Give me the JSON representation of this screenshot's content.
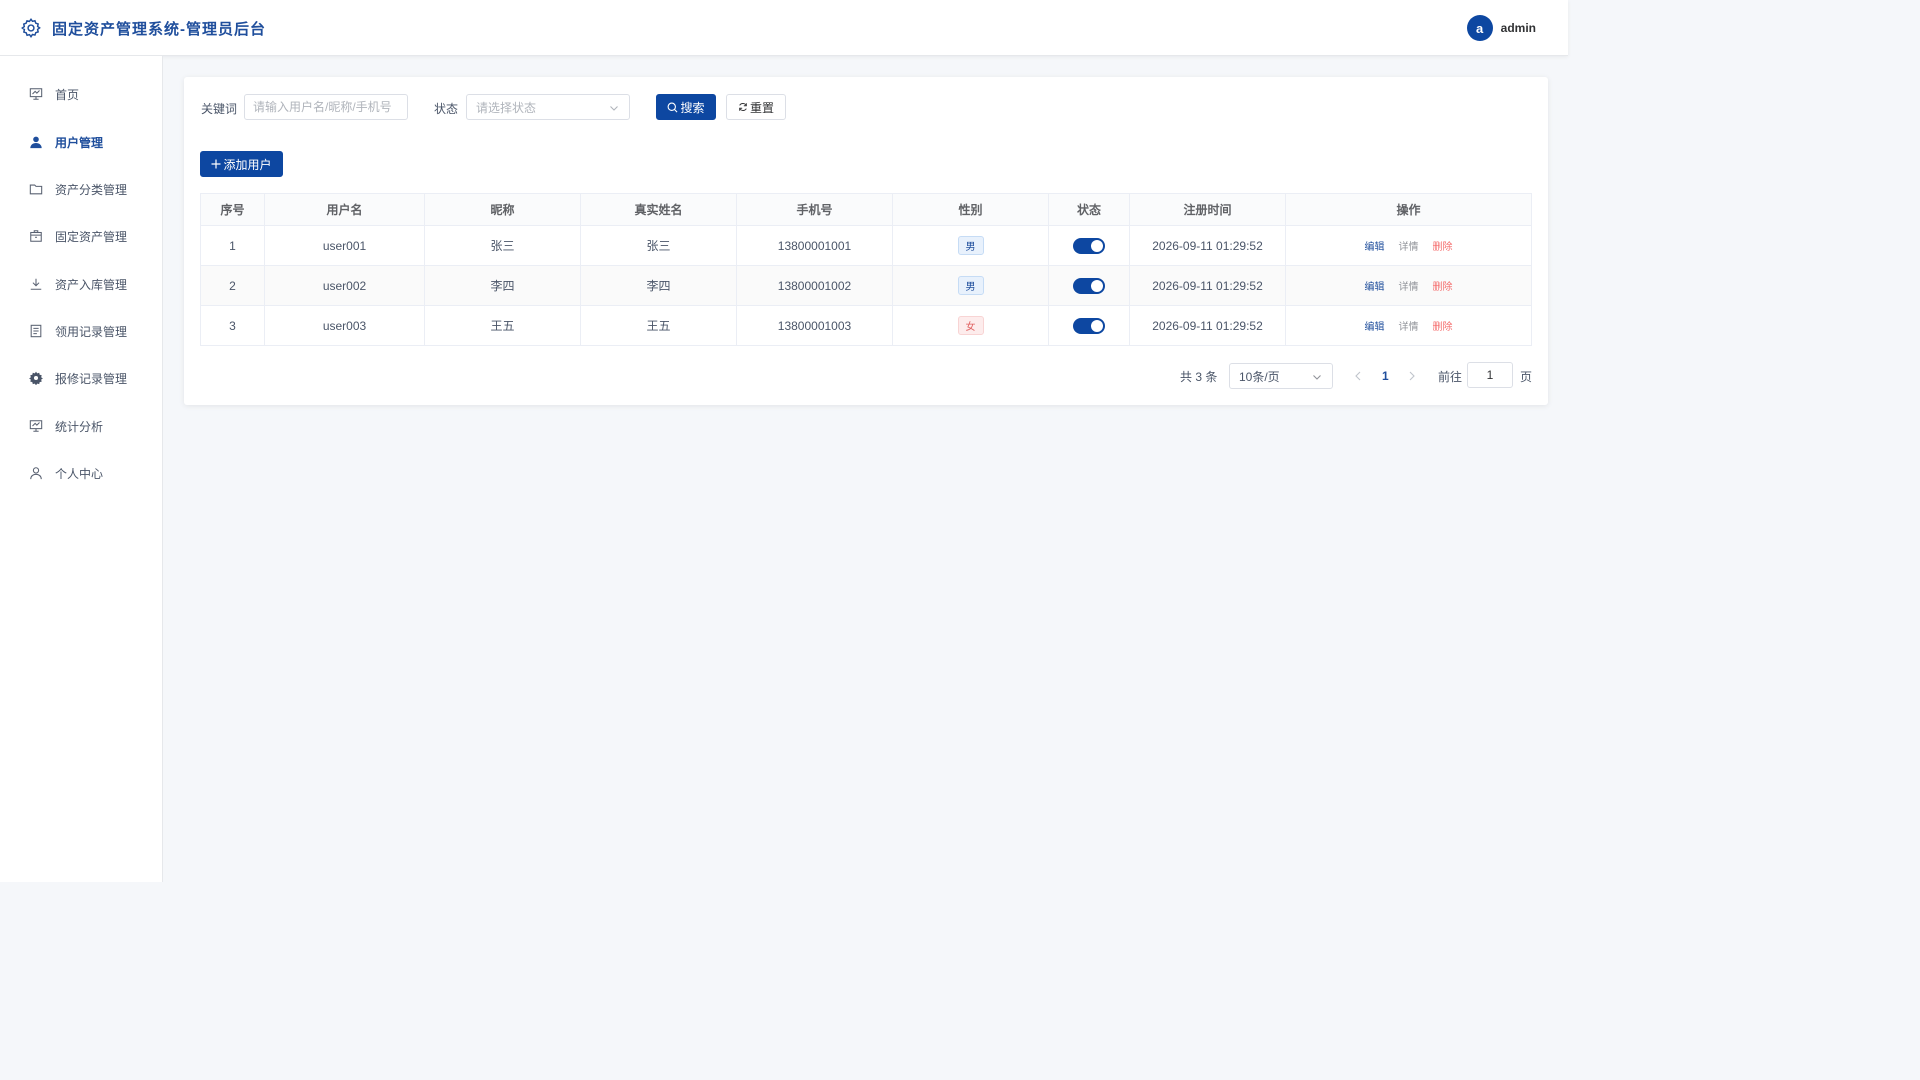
{
  "header": {
    "title": "固定资产管理系统-管理员后台",
    "avatar_letter": "a",
    "username": "admin"
  },
  "sidebar": {
    "items": [
      {
        "label": "首页",
        "icon": "presentation-icon",
        "active": false
      },
      {
        "label": "用户管理",
        "icon": "user-filled-icon",
        "active": true
      },
      {
        "label": "资产分类管理",
        "icon": "folder-icon",
        "active": false
      },
      {
        "label": "固定资产管理",
        "icon": "box-icon",
        "active": false
      },
      {
        "label": "资产入库管理",
        "icon": "download-icon",
        "active": false
      },
      {
        "label": "领用记录管理",
        "icon": "document-icon",
        "active": false
      },
      {
        "label": "报修记录管理",
        "icon": "gear-icon",
        "active": false
      },
      {
        "label": "统计分析",
        "icon": "chart-board-icon",
        "active": false
      },
      {
        "label": "个人中心",
        "icon": "user-outline-icon",
        "active": false
      }
    ]
  },
  "filters": {
    "keyword_label": "关键词",
    "keyword_placeholder": "请输入用户名/昵称/手机号",
    "status_label": "状态",
    "status_placeholder": "请选择状态",
    "search_button": "搜索",
    "reset_button": "重置"
  },
  "actions": {
    "add_button": "添加用户"
  },
  "table": {
    "columns": [
      "序号",
      "用户名",
      "昵称",
      "真实姓名",
      "手机号",
      "性别",
      "状态",
      "注册时间",
      "操作"
    ],
    "rows": [
      {
        "index": "1",
        "username": "user001",
        "nickname": "张三",
        "realname": "张三",
        "phone": "13800001001",
        "gender": "男",
        "enabled": true,
        "registered": "2026-09-11 01:29:52"
      },
      {
        "index": "2",
        "username": "user002",
        "nickname": "李四",
        "realname": "李四",
        "phone": "13800001002",
        "gender": "男",
        "enabled": true,
        "registered": "2026-09-11 01:29:52"
      },
      {
        "index": "3",
        "username": "user003",
        "nickname": "王五",
        "realname": "王五",
        "phone": "13800001003",
        "gender": "女",
        "enabled": true,
        "registered": "2026-09-11 01:29:52"
      }
    ],
    "ops": {
      "edit": "编辑",
      "detail": "详情",
      "delete": "删除"
    }
  },
  "pagination": {
    "total_text": "共 3 条",
    "page_size": "10条/页",
    "current_page": "1",
    "goto_label": "前往",
    "goto_value": "1",
    "page_suffix": "页"
  },
  "colors": {
    "primary": "#0d47a1",
    "title": "#1f4e9c",
    "danger": "#f56c6c"
  }
}
